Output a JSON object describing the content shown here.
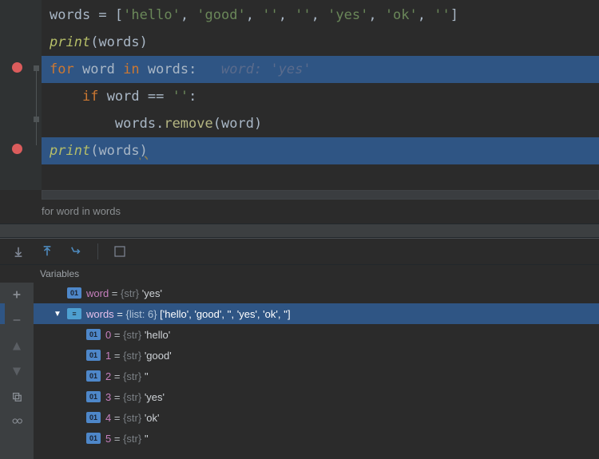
{
  "code": {
    "line1_tokens": {
      "ident": "words",
      "eq": " = ",
      "list_items": "['hello', 'good', '', '', 'yes', 'ok', '']"
    },
    "line2_tokens": {
      "fn": "print",
      "open": "(",
      "arg": "words",
      "close": ")"
    },
    "line3_tokens": {
      "for": "for",
      "sp": " ",
      "var": "word",
      "in": " in ",
      "iter": "words",
      "colon": ":",
      "hint": "word: 'yes'"
    },
    "line4_tokens": {
      "if": "if",
      "sp": " ",
      "var": "word",
      "eq": " == ",
      "str": "''",
      "colon": ":"
    },
    "line5_tokens": {
      "obj": "words",
      "dot": ".",
      "meth": "remove",
      "open": "(",
      "arg": "word",
      "close": ")"
    },
    "line6_tokens": {
      "fn": "print",
      "open": "(",
      "arg": "words",
      "close": ")"
    }
  },
  "breadcrumb": "for word in words",
  "variables_label": "Variables",
  "vars": {
    "word": {
      "name": "word",
      "type": "{str}",
      "value": "'yes'"
    },
    "words": {
      "name": "words",
      "type": "{list: 6}",
      "repr": "['hello', 'good', '', 'yes', 'ok', '']",
      "items": [
        {
          "idx": "0",
          "type": "{str}",
          "val": "'hello'"
        },
        {
          "idx": "1",
          "type": "{str}",
          "val": "'good'"
        },
        {
          "idx": "2",
          "type": "{str}",
          "val": "''"
        },
        {
          "idx": "3",
          "type": "{str}",
          "val": "'yes'"
        },
        {
          "idx": "4",
          "type": "{str}",
          "val": "'ok'"
        },
        {
          "idx": "5",
          "type": "{str}",
          "val": "''"
        }
      ]
    }
  },
  "badge_text": "01"
}
